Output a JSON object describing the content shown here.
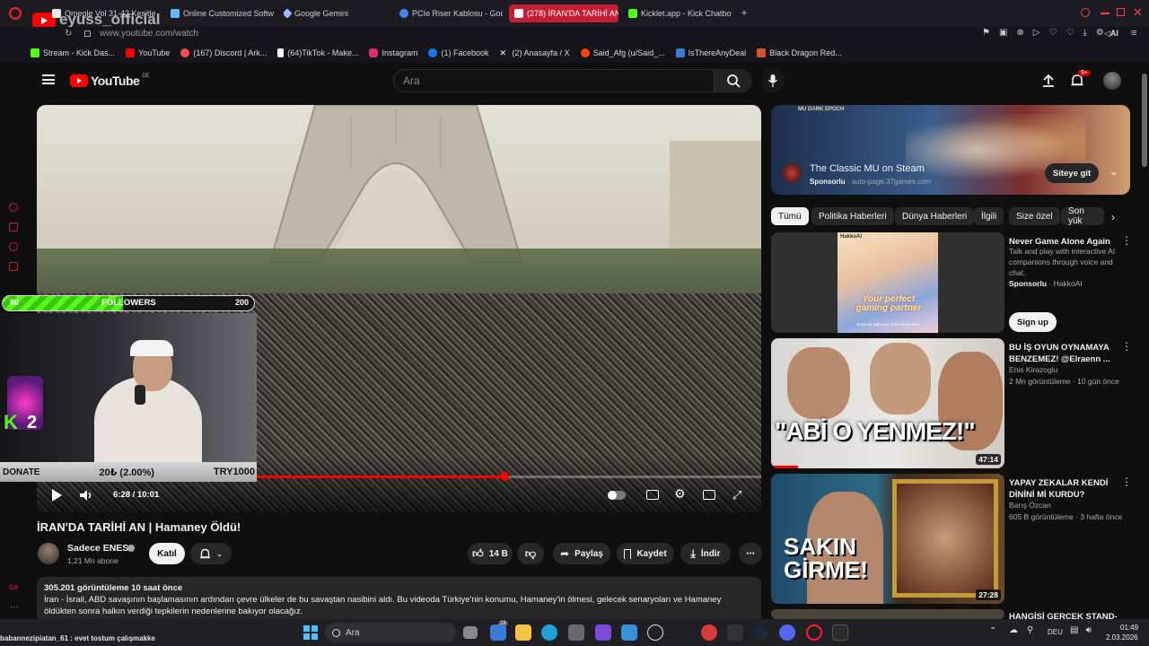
{
  "browser": {
    "tabs": [
      {
        "label": "Omegle Vol 31-42 Kesitle",
        "color": "#e8e8e8"
      },
      {
        "label": "Online Customized Softw",
        "color": "#6bb8ff"
      },
      {
        "label": "Google Gemini",
        "color": "#9bb8ff"
      },
      {
        "label": "PCIe Riser Kablosu - Goo",
        "color": "#4285f4"
      },
      {
        "label": "(278) İRAN'DA TARİHİ AN",
        "color": "#ff2d2d"
      },
      {
        "label": "Kicklet.app - Kick Chatbot",
        "color": "#53fc18"
      }
    ],
    "url": "www.youtube.com/watch",
    "streamer_overlay_name": "eyuss_official",
    "bookmarks": [
      {
        "label": "Stream - Kick Das...",
        "color": "#53fc18"
      },
      {
        "label": "YouTube",
        "color": "#ff0000"
      },
      {
        "label": "(167) Discord | Ark...",
        "color": "#ff4d4d"
      },
      {
        "label": "(64)TikTok - Make...",
        "color": "#ffffff"
      },
      {
        "label": "Instagram",
        "color": "#e1306c"
      },
      {
        "label": "(1) Facebook",
        "color": "#1877f2"
      },
      {
        "label": "(2) Anasayfa / X",
        "color": "#ffffff"
      },
      {
        "label": "Said_Afg (u/Said_...",
        "color": "#ff4500"
      },
      {
        "label": "IsThereAnyDeal",
        "color": "#3a7bd5"
      },
      {
        "label": "Black Dragon Red...",
        "color": "#d9542b"
      }
    ]
  },
  "header": {
    "logo": "YouTube",
    "region": "DE",
    "search_placeholder": "Ara",
    "notif_badge": "9+"
  },
  "player": {
    "overlay": {
      "goal_start": "80",
      "goal_label": "FOLLOWERS",
      "goal_end": "200",
      "goal_fraction": 0.48,
      "kick_count": "2",
      "donate_label": "DONATE",
      "donate_progress": "20₺ (2.00%)",
      "donate_target": "TRY1000"
    },
    "time": "6:28 / 10:01",
    "progress_fraction": 0.646
  },
  "video": {
    "title": "İRAN'DA TARİHİ AN | Hamaney Öldü!",
    "channel": "Sadece ENES",
    "subscribers": "1,21 Mn abone",
    "join_label": "Katıl",
    "likes": "14 B",
    "share_label": "Paylaş",
    "save_label": "Kaydet",
    "download_label": "İndir",
    "views_line": "305.201 görüntüleme  10 saat önce",
    "description": "İran - İsrail, ABD savaşının başlamasının ardından çevre ülkeler de bu savaştan nasibini aldı. Bu videoda Türkiye'nin konumu, Hamaney'in ölmesi, gelecek senaryoları ve Hamaney öldükten sonra halkın verdiği tepkilerin nedenlerine bakıyor olacağız."
  },
  "ad": {
    "game_logo": "MU DARK EPOCH",
    "title": "The Classic MU on Steam",
    "sponsor": "Sponsorlu",
    "domain": "auto-page.37games.com",
    "cta": "Siteye git"
  },
  "chips": [
    "Tümü",
    "Politika Haberleri",
    "Dünya Haberleri",
    "İlgili",
    "Size özel",
    "Son yük"
  ],
  "recommendations": [
    {
      "title": "Never Game Alone Again",
      "desc": "Talk and play with interactive AI companions through voice and chat.",
      "sponsor": "Sponsorlu",
      "advertiser": "HakkoAI",
      "cta": "Sign up",
      "thumb_text": "Your perfect gaming partner",
      "thumb_sub": "Team up with your AI for more wins",
      "badge": "HakkoAI"
    },
    {
      "title": "BU İŞ OYUN OYNAMAYA BENZEMEZ! @Elraenn ...",
      "channel": "Enis Kirazoglu",
      "meta": "2 Mn görüntüleme · 10 gün önce",
      "duration": "47:14",
      "thumb_text": "\"ABİ O YENMEZ!\""
    },
    {
      "title": "YAPAY ZEKALAR KENDİ DİNİNİ Mİ KURDU?",
      "channel": "Barış Özcan",
      "meta": "605 B görüntüleme · 3 hafta önce",
      "duration": "27:28",
      "thumb_text": "SAKIN GİRME!"
    },
    {
      "title": "HANGİSİ GERÇEK STAND-"
    }
  ],
  "taskbar": {
    "search": "Ara",
    "lang": "DEU",
    "time": "01:49",
    "date": "2.03.2026",
    "chat_line": "babannezipiatan_61 : evet tostum çalışmakke",
    "mail_badge": "28"
  },
  "colors": {
    "accent": "#ff0000",
    "kick_green": "#53fc18",
    "bg": "#0f0f0f"
  }
}
